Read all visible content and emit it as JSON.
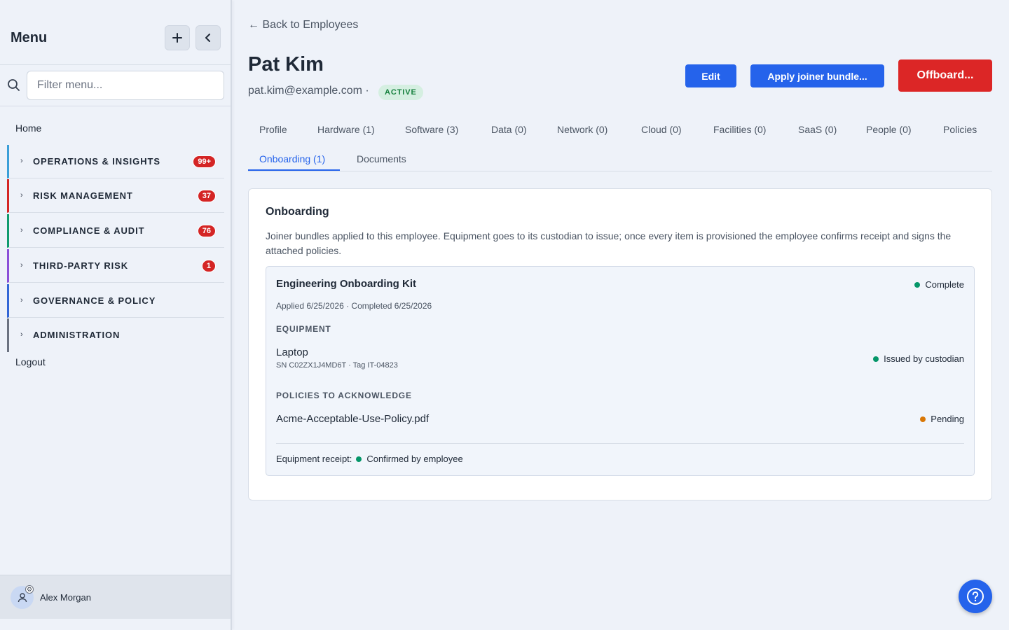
{
  "sidebar": {
    "title": "Menu",
    "add_icon": "plus-icon",
    "collapse_icon": "chevron-left-icon",
    "filter_placeholder": "Filter menu...",
    "home": "Home",
    "groups": [
      {
        "label": "OPERATIONS & INSIGHTS",
        "badge": "99+",
        "color": "#3b9fd8"
      },
      {
        "label": "RISK MANAGEMENT",
        "badge": "37",
        "color": "#d42525"
      },
      {
        "label": "COMPLIANCE & AUDIT",
        "badge": "76",
        "color": "#0f9b6e"
      },
      {
        "label": "THIRD-PARTY RISK",
        "badge": "1",
        "color": "#8b4fd8"
      },
      {
        "label": "GOVERNANCE & POLICY",
        "badge": "",
        "color": "#3366d6"
      },
      {
        "label": "ADMINISTRATION",
        "badge": "",
        "color": "#6b7280"
      }
    ],
    "logout": "Logout",
    "user": "Alex Morgan"
  },
  "header": {
    "back": "← Back to Employees",
    "name": "Pat Kim",
    "email": "pat.kim@example.com ·",
    "status": "ACTIVE",
    "edit": "Edit",
    "apply": "Apply joiner bundle...",
    "offboard": "Offboard..."
  },
  "tabs": [
    "Profile",
    "Hardware (1)",
    "Software (3)",
    "Data (0)",
    "Network (0)",
    "Cloud (0)",
    "Facilities (0)",
    "SaaS (0)",
    "People (0)",
    "Policies",
    "Onboarding (1)",
    "Documents"
  ],
  "active_tab": "Onboarding (1)",
  "card": {
    "title": "Onboarding",
    "description": "Joiner bundles applied to this employee. Equipment goes to its custodian to issue; once every item is provisioned the employee confirms receipt and signs the attached policies.",
    "bundle": {
      "title": "Engineering Onboarding Kit",
      "status": "Complete",
      "meta": "Applied 6/25/2026 · Completed 6/25/2026",
      "equipment_heading": "EQUIPMENT",
      "equipment": {
        "name": "Laptop",
        "sub": "SN C02ZX1J4MD6T · Tag IT-04823",
        "status": "Issued by custodian"
      },
      "policies_heading": "POLICIES TO ACKNOWLEDGE",
      "policy": {
        "name": "Acme-Acceptable-Use-Policy.pdf",
        "status": "Pending"
      },
      "receipt_label": "Equipment receipt:",
      "receipt_status": "Confirmed by employee"
    }
  },
  "help_icon": "question-circle-icon",
  "colors": {
    "accent": "#2563eb",
    "danger": "#dc2626",
    "success": "#059669",
    "warning": "#d97706"
  }
}
